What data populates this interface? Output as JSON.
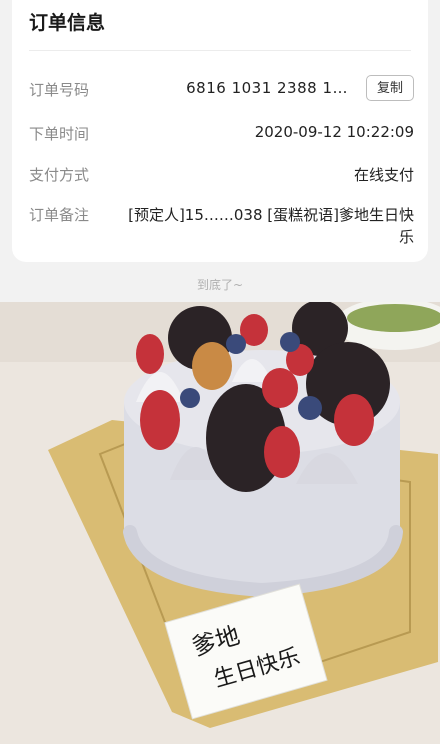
{
  "card": {
    "title": "订单信息",
    "order_no_label": "订单号码",
    "order_no_value": "6816 1031 2388 1…",
    "copy_label": "复制",
    "time_label": "下单时间",
    "time_value": "2020-09-12 10:22:09",
    "pay_label": "支付方式",
    "pay_value": "在线支付",
    "note_label": "订单备注",
    "note_value": "[预定人]15……038 [蛋糕祝语]爹地生日快乐"
  },
  "end_text": "到底了~",
  "photo": {
    "card_text_line1": "爹地",
    "card_text_line2": "生日快乐"
  },
  "colors": {
    "board": "#d9bc73",
    "frosting": "#dcdde5",
    "oreo": "#2b2326",
    "strawberry": "#c5323a",
    "blueberry": "#3a4a7a"
  }
}
